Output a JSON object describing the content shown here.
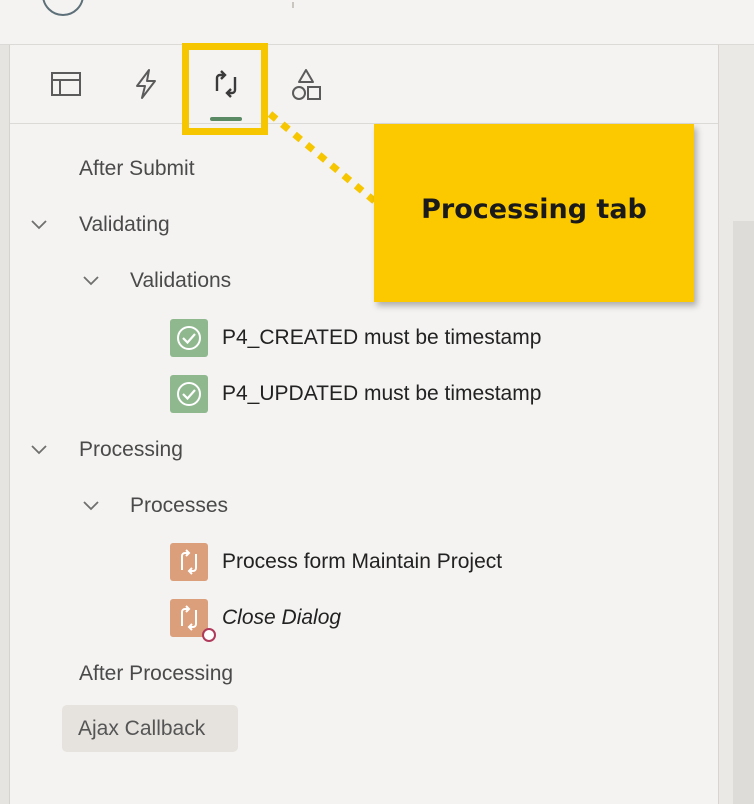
{
  "tabs": [
    {
      "name": "rendering",
      "icon": "layout-icon",
      "selected": false
    },
    {
      "name": "dynamic-actions",
      "icon": "lightning-icon",
      "selected": false
    },
    {
      "name": "processing",
      "icon": "process-arrows-icon",
      "selected": true
    },
    {
      "name": "shared-components",
      "icon": "shapes-icon",
      "selected": false
    }
  ],
  "callout": {
    "text": "Processing tab"
  },
  "tree": {
    "after_submit": "After Submit",
    "validating": "Validating",
    "validations": "Validations",
    "validation_items": [
      "P4_CREATED must be timestamp",
      "P4_UPDATED must be timestamp"
    ],
    "processing": "Processing",
    "processes": "Processes",
    "process_items": [
      "Process form Maintain Project",
      "Close Dialog"
    ],
    "after_processing": "After Processing",
    "ajax_callback": "Ajax Callback"
  },
  "colors": {
    "highlight": "#f6c600",
    "callout": "#fcc900",
    "validation_badge": "#8fb88f",
    "process_badge": "#dba07b",
    "tab_underline": "#5a8a63"
  }
}
